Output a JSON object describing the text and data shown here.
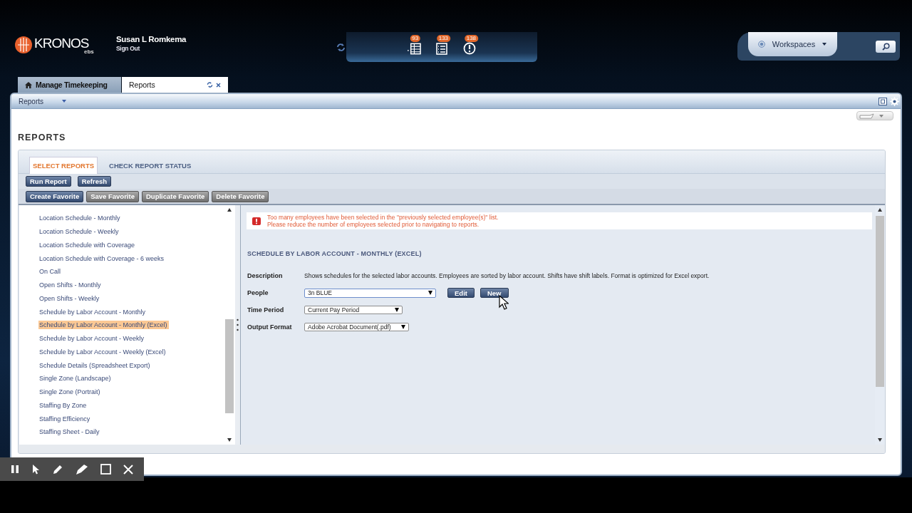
{
  "header": {
    "logo": {
      "name": "KRONOS",
      "suffix": "ebs"
    },
    "user_name": "Susan L Romkema",
    "sign_out": "Sign Out",
    "notifications": [
      {
        "count": "93"
      },
      {
        "count": "133"
      },
      {
        "count": "138"
      }
    ],
    "workspaces": "Workspaces"
  },
  "tabs": [
    {
      "label": "Manage Timekeeping",
      "selected": false
    },
    {
      "label": "Reports",
      "selected": true
    }
  ],
  "menu": {
    "label": "Reports"
  },
  "page_title": "REPORTS",
  "report_tabs": [
    {
      "label": "SELECT REPORTS",
      "selected": true
    },
    {
      "label": "CHECK REPORT STATUS",
      "selected": false
    }
  ],
  "action_buttons": [
    "Run Report",
    "Refresh"
  ],
  "favorite_buttons": [
    {
      "label": "Create Favorite",
      "disabled": false
    },
    {
      "label": "Save Favorite",
      "disabled": true
    },
    {
      "label": "Duplicate Favorite",
      "disabled": true
    },
    {
      "label": "Delete Favorite",
      "disabled": true
    }
  ],
  "report_list": [
    {
      "label": "Location Schedule - Monthly",
      "selected": false
    },
    {
      "label": "Location Schedule - Weekly",
      "selected": false
    },
    {
      "label": "Location Schedule with Coverage",
      "selected": false
    },
    {
      "label": "Location Schedule with Coverage - 6 weeks",
      "selected": false
    },
    {
      "label": "On Call",
      "selected": false
    },
    {
      "label": "Open Shifts - Monthly",
      "selected": false
    },
    {
      "label": "Open Shifts - Weekly",
      "selected": false
    },
    {
      "label": "Schedule by Labor Account - Monthly",
      "selected": false
    },
    {
      "label": "Schedule by Labor Account - Monthly (Excel)",
      "selected": true
    },
    {
      "label": "Schedule by Labor Account - Weekly",
      "selected": false
    },
    {
      "label": "Schedule by Labor Account - Weekly (Excel)",
      "selected": false
    },
    {
      "label": "Schedule Details (Spreadsheet Export)",
      "selected": false
    },
    {
      "label": "Single Zone (Landscape)",
      "selected": false
    },
    {
      "label": "Single Zone (Portrait)",
      "selected": false
    },
    {
      "label": "Staffing By Zone",
      "selected": false
    },
    {
      "label": "Staffing Efficiency",
      "selected": false
    },
    {
      "label": "Staffing Sheet - Daily",
      "selected": false
    }
  ],
  "alert": {
    "lines": [
      "Too many employees have been selected in the \"previously selected employee(s)\" list.",
      "Please reduce the number of employees selected prior to navigating to reports."
    ]
  },
  "report": {
    "title": "SCHEDULE BY LABOR ACCOUNT - MONTHLY (EXCEL)",
    "fields": [
      {
        "kind": "text",
        "label": "Description",
        "value": "Shows schedules for the selected labor accounts. Employees are sorted by labor account. Shifts have shift labels. Format is optimized for Excel export."
      },
      {
        "kind": "select",
        "label": "People",
        "value": "3n BLUE",
        "buttons": [
          "Edit",
          "New"
        ]
      },
      {
        "kind": "select",
        "label": "Time Period",
        "value": "Current Pay Period"
      },
      {
        "kind": "select",
        "label": "Output Format",
        "value": "Adobe Acrobat Document(.pdf)"
      }
    ]
  }
}
